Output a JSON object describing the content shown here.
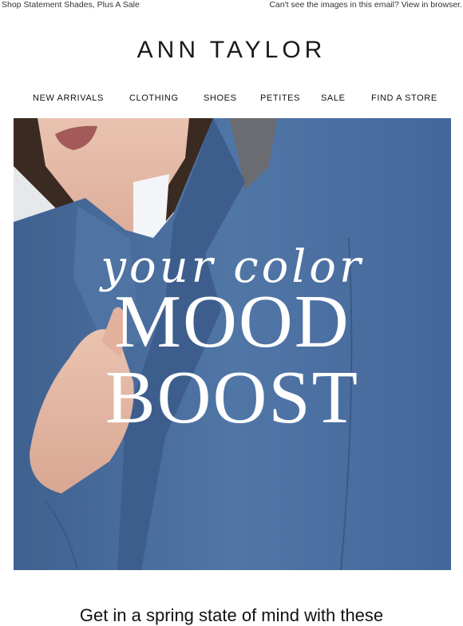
{
  "preheader": {
    "left_text": "Shop Statement Shades, Plus A Sale",
    "right_text": "Can't see the images in this email? View in browser."
  },
  "brand": {
    "logo_text": "ANN TAYLOR"
  },
  "nav": {
    "items": [
      "NEW ARRIVALS",
      "CLOTHING",
      "SHOES",
      "PETITES",
      "SALE",
      "FIND A STORE"
    ]
  },
  "hero": {
    "script_text": "your color",
    "headline_line1": "MOOD",
    "headline_line2": "BOOST",
    "colors": {
      "jacket": "#4a6c9b",
      "background": "#e7e8ea"
    }
  },
  "body": {
    "intro": "Get in a spring state of mind with these"
  }
}
